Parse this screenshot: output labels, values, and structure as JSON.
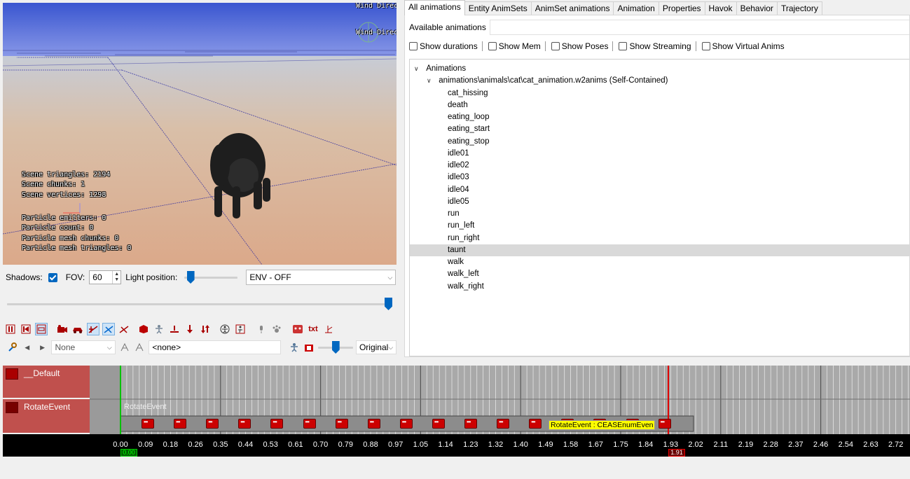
{
  "viewport": {
    "wind_label_top": "Wind Direc",
    "wind_label_2": "Wind Direc",
    "stats_scene": "Scene triangles: 2194\nScene chunks: 1\nScene vertices: 1298",
    "stats_particles": "Particle emitters: 0\nParticle count: 0\nParticle mesh chunks: 0\nParticle mesh triangles: 0"
  },
  "controls": {
    "shadows_label": "Shadows:",
    "shadows_checked": true,
    "fov_label": "FOV:",
    "fov_value": "60",
    "light_label": "Light position:",
    "light_value": 0.05,
    "env_selected": "ENV - OFF",
    "timeline_zoom_value": 1.0,
    "anim_slider_value": 0.5
  },
  "toolbar2": {
    "none_select": "None",
    "none_field": "<none>",
    "original_select": "Original"
  },
  "tabs": [
    "All animations",
    "Entity AnimSets",
    "AnimSet animations",
    "Animation",
    "Properties",
    "Havok",
    "Behavior",
    "Trajectory"
  ],
  "panel": {
    "available_label": "Available animations",
    "options": [
      "Show durations",
      "Show Mem",
      "Show Poses",
      "Show Streaming",
      "Show Virtual Anims"
    ]
  },
  "tree": {
    "root": "Animations",
    "file": "animations\\animals\\cat\\cat_animation.w2anims (Self-Contained)",
    "items": [
      "cat_hissing",
      "death",
      "eating_loop",
      "eating_start",
      "eating_stop",
      "idle01",
      "idle02",
      "idle03",
      "idle04",
      "idle05",
      "run",
      "run_left",
      "run_right",
      "taunt",
      "walk",
      "walk_left",
      "walk_right"
    ],
    "selected": "taunt"
  },
  "timeline": {
    "tracks": [
      "__Default",
      "RotateEvent"
    ],
    "event_block_label": "RotateEvent",
    "event_tag": "RotateEvent : CEASEnumEven",
    "ticks": [
      "0.00",
      "0.09",
      "0.18",
      "0.26",
      "0.35",
      "0.44",
      "0.53",
      "0.61",
      "0.70",
      "0.79",
      "0.88",
      "0.97",
      "1.05",
      "1.14",
      "1.23",
      "1.32",
      "1.40",
      "1.49",
      "1.58",
      "1.67",
      "1.75",
      "1.84",
      "1.93",
      "2.02",
      "2.11",
      "2.19",
      "2.28",
      "2.37",
      "2.46",
      "2.54",
      "2.63",
      "2.72"
    ],
    "start_marker": "0.00",
    "end_marker": "1.91"
  },
  "colors": {
    "track_red": "#c0504d",
    "event_yellow": "#ffff00",
    "accent_blue": "#0067c0",
    "start_green": "#00c000",
    "end_red": "#e00000"
  }
}
